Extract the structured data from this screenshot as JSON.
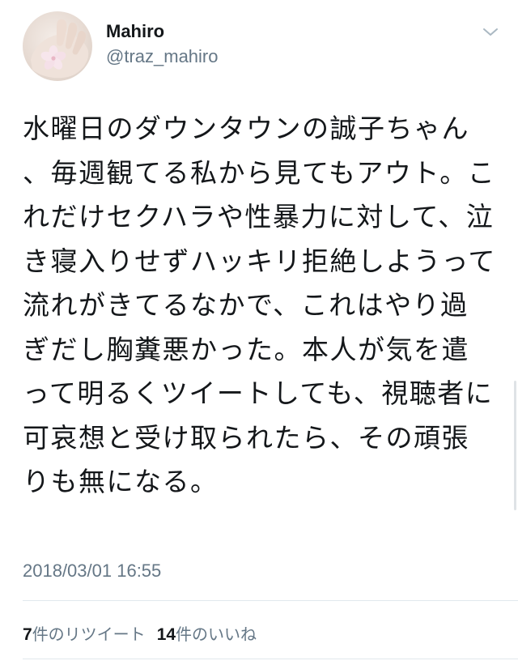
{
  "author": {
    "display_name": "Mahiro",
    "handle": "@traz_mahiro"
  },
  "tweet": {
    "text": "水曜日のダウンタウンの誠子ちゃん、毎週観てる私から見てもアウト。これだけセクハラや性暴力に対して、泣き寝入りせずハッキリ拒絶しようって流れがきてるなかで、これはやり過ぎだし胸糞悪かった。本人が気を遣って明るくツイートしても、視聴者に可哀想と受け取られたら、その頑張りも無になる。",
    "timestamp": "2018/03/01 16:55"
  },
  "stats": {
    "retweet_count": "7",
    "retweet_label": "件のリツイート",
    "like_count": "14",
    "like_label": "件のいいね"
  },
  "icons": {
    "menu": "chevron-down-icon",
    "avatar": "hand-holding-flower"
  },
  "colors": {
    "primary_text": "#14171a",
    "secondary_text": "#657786",
    "divider": "#e1e8ed"
  }
}
